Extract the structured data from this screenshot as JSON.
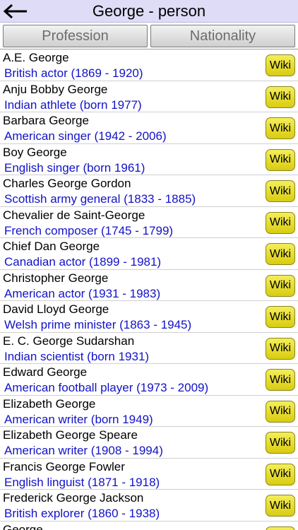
{
  "header": {
    "title": "George - person",
    "back_icon": "back-arrow-icon"
  },
  "tabs": [
    {
      "label": "Profession"
    },
    {
      "label": "Nationality"
    }
  ],
  "wiki_label": "Wiki",
  "people": [
    {
      "name": "A.E. George",
      "desc": "British actor (1869 - 1920)"
    },
    {
      "name": "Anju Bobby George",
      "desc": "Indian athlete (born 1977)"
    },
    {
      "name": "Barbara George",
      "desc": "American singer (1942 - 2006)"
    },
    {
      "name": "Boy George",
      "desc": "English singer (born 1961)"
    },
    {
      "name": "Charles George Gordon",
      "desc": "Scottish army general (1833 - 1885)"
    },
    {
      "name": "Chevalier de Saint-George",
      "desc": "French composer (1745 - 1799)"
    },
    {
      "name": "Chief Dan George",
      "desc": "Canadian actor (1899 - 1981)"
    },
    {
      "name": "Christopher George",
      "desc": "American actor (1931 - 1983)"
    },
    {
      "name": "David Lloyd George",
      "desc": "Welsh prime minister (1863 - 1945)"
    },
    {
      "name": "E. C. George Sudarshan",
      "desc": "Indian scientist (born 1931)"
    },
    {
      "name": "Edward George",
      "desc": "American football player (1973 - 2009)"
    },
    {
      "name": "Elizabeth George",
      "desc": "American writer (born 1949)"
    },
    {
      "name": "Elizabeth George Speare",
      "desc": "American writer (1908 - 1994)"
    },
    {
      "name": "Francis George Fowler",
      "desc": "English linguist (1871 - 1918)"
    },
    {
      "name": "Frederick George Jackson",
      "desc": "British explorer (1860 - 1938)"
    },
    {
      "name": "George",
      "desc": ""
    }
  ]
}
